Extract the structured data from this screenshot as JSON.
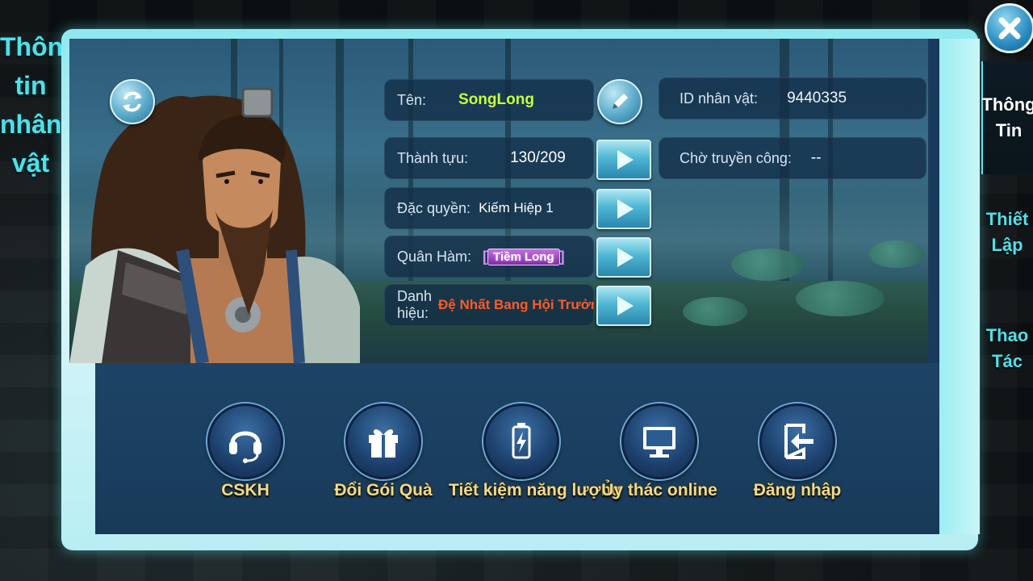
{
  "window": {
    "left_title": "Thông\ntin\nnhân\nvật"
  },
  "profile": {
    "name_label": "Tên:",
    "name_value": "SongLong",
    "id_label": "ID nhân vật:",
    "id_value": "9440335",
    "achievement_label": "Thành tựu:",
    "achievement_value": "130/209",
    "transfer_label": "Chờ truyền công:",
    "transfer_value": "--",
    "privilege_label": "Đặc quyền:",
    "privilege_value": "Kiếm Hiệp 1",
    "rank_label": "Quân Hàm:",
    "rank_value": "Tiềm Long",
    "title_label": "Danh hiệu:",
    "title_value": "Đệ Nhất Bang Hội Trưởn"
  },
  "actions": [
    {
      "label": "CSKH",
      "icon": "headset-icon"
    },
    {
      "label": "Đổi Gói Quà",
      "icon": "gift-icon"
    },
    {
      "label": "Tiết kiệm năng lượng",
      "icon": "battery-icon"
    },
    {
      "label": "Ủy thác online",
      "icon": "monitor-icon"
    },
    {
      "label": "Đăng nhập",
      "icon": "login-icon"
    }
  ],
  "tabs": [
    {
      "label": "Thông\nTin",
      "active": true
    },
    {
      "label": "Thiết\nLập",
      "active": false
    },
    {
      "label": "Thao\nTác",
      "active": false
    }
  ],
  "colors": {
    "name_value": "#c6ff3a",
    "title_value": "#ff5a2a",
    "accent": "#4fe0e8",
    "action_label": "#f2d98a"
  }
}
